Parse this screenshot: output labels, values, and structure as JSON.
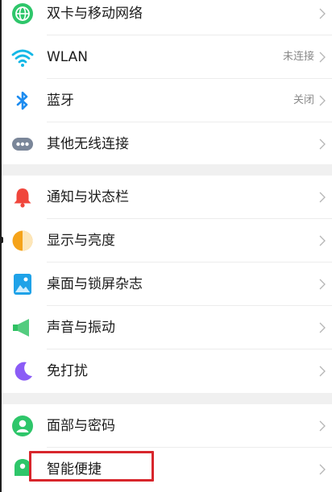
{
  "groups": [
    {
      "items": [
        {
          "label": "双卡与移动网络",
          "value": "",
          "icon": "globe-icon"
        },
        {
          "label": "WLAN",
          "value": "未连接",
          "icon": "wifi-icon"
        },
        {
          "label": "蓝牙",
          "value": "关闭",
          "icon": "bluetooth-icon"
        },
        {
          "label": "其他无线连接",
          "value": "",
          "icon": "more-connections-icon"
        }
      ]
    },
    {
      "items": [
        {
          "label": "通知与状态栏",
          "value": "",
          "icon": "bell-icon"
        },
        {
          "label": "显示与亮度",
          "value": "",
          "icon": "brightness-icon"
        },
        {
          "label": "桌面与锁屏杂志",
          "value": "",
          "icon": "wallpaper-icon"
        },
        {
          "label": "声音与振动",
          "value": "",
          "icon": "speaker-icon"
        },
        {
          "label": "免打扰",
          "value": "",
          "icon": "moon-icon"
        }
      ]
    },
    {
      "items": [
        {
          "label": "面部与密码",
          "value": "",
          "icon": "face-icon"
        },
        {
          "label": "智能便捷",
          "value": "",
          "icon": "smart-assist-icon"
        }
      ]
    }
  ],
  "colors": {
    "globe": "#2ec66a",
    "wifi": "#15b8e6",
    "bluetooth": "#1d8cf0",
    "more": "#7a8699",
    "bell": "#f0463c",
    "brightness": "#f5a31a",
    "wallpaper": "#1fa2e8",
    "speaker": "#2fc163",
    "moon": "#8b5cf6",
    "face": "#2ec66a",
    "smart": "#2ec66a",
    "highlight": "#d8262c"
  }
}
